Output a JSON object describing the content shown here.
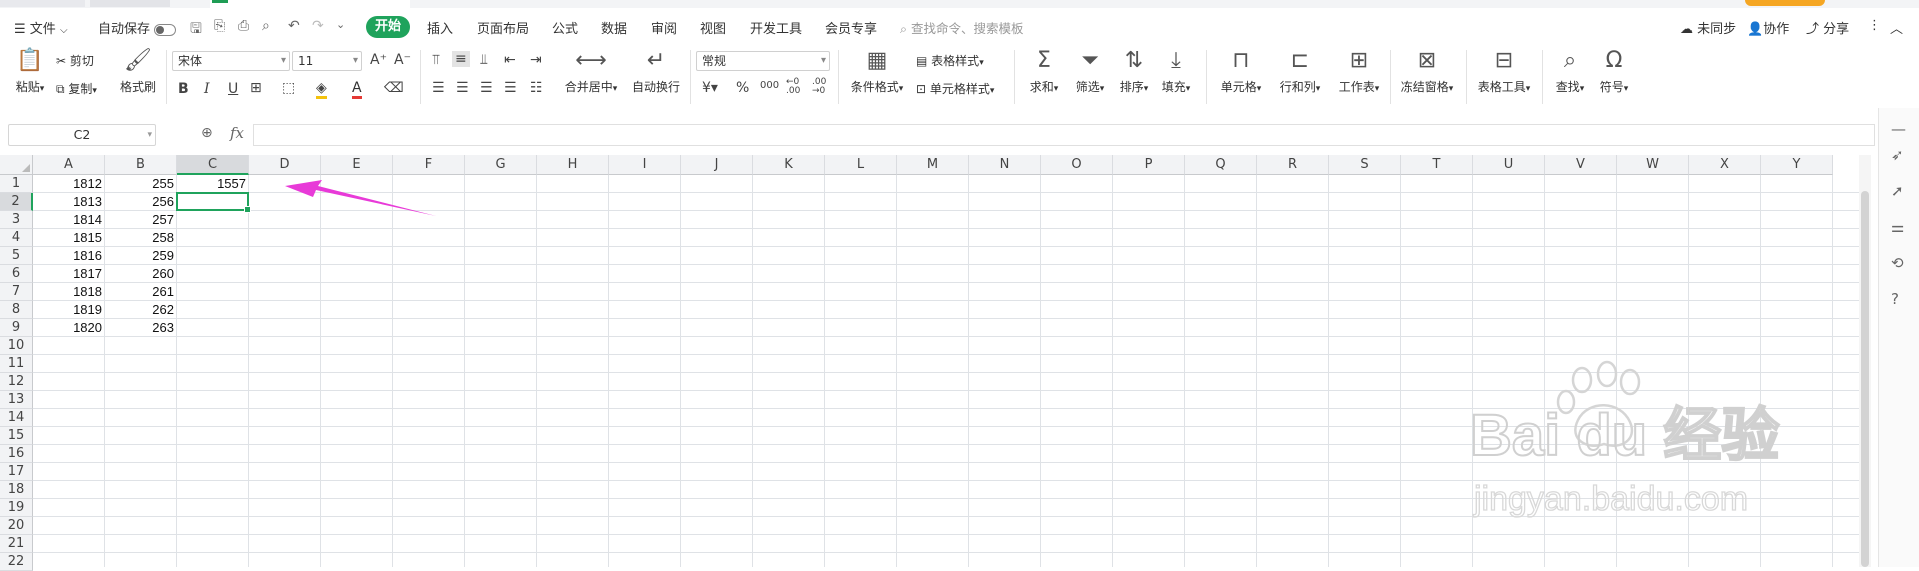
{
  "menubar": {
    "file": "文件",
    "autosave": "自动保存",
    "tabs": [
      "开始",
      "插入",
      "页面布局",
      "公式",
      "数据",
      "审阅",
      "视图",
      "开发工具",
      "会员专享"
    ],
    "search_placeholder": "查找命令、搜索模板",
    "unsync": "未同步",
    "collab": "协作",
    "share": "分享"
  },
  "ribbon": {
    "paste": "粘贴",
    "cut": "剪切",
    "copy": "复制",
    "format_painter": "格式刷",
    "font_name": "宋体",
    "font_size": "11",
    "merge_center": "合并居中",
    "wrap": "自动换行",
    "number_format": "常规",
    "cond_format": "条件格式",
    "table_style": "表格样式",
    "cell_style": "单元格样式",
    "sum": "求和",
    "filter": "筛选",
    "sort": "排序",
    "fill": "填充",
    "cell": "单元格",
    "row_col": "行和列",
    "sheet": "工作表",
    "freeze": "冻结窗格",
    "table_tools": "表格工具",
    "find": "查找",
    "symbol": "符号"
  },
  "formulabar": {
    "namebox": "C2",
    "fx": "fx",
    "formula": ""
  },
  "grid": {
    "columns": [
      "A",
      "B",
      "C",
      "D",
      "E",
      "F",
      "G",
      "H",
      "I",
      "J",
      "K",
      "L",
      "M",
      "N",
      "O",
      "P",
      "Q",
      "R",
      "S",
      "T",
      "U",
      "V",
      "W",
      "X",
      "Y"
    ],
    "rows": [
      "1",
      "2",
      "3",
      "4",
      "5",
      "6",
      "7",
      "8",
      "9",
      "10",
      "11",
      "12",
      "13",
      "14",
      "15",
      "16",
      "17",
      "18",
      "19",
      "20",
      "21",
      "22"
    ],
    "active_cell": "C2",
    "data": [
      [
        "1812",
        "255",
        "1557"
      ],
      [
        "1813",
        "256",
        ""
      ],
      [
        "1814",
        "257",
        ""
      ],
      [
        "1815",
        "258",
        ""
      ],
      [
        "1816",
        "259",
        ""
      ],
      [
        "1817",
        "260",
        ""
      ],
      [
        "1818",
        "261",
        ""
      ],
      [
        "1819",
        "262",
        ""
      ],
      [
        "1820",
        "263",
        ""
      ]
    ]
  },
  "colors": {
    "accent": "#1fa35c",
    "arrow": "#e83ad8"
  },
  "watermark": {
    "brand": "Bai du 经验",
    "url": "jingyan.baidu.com"
  }
}
